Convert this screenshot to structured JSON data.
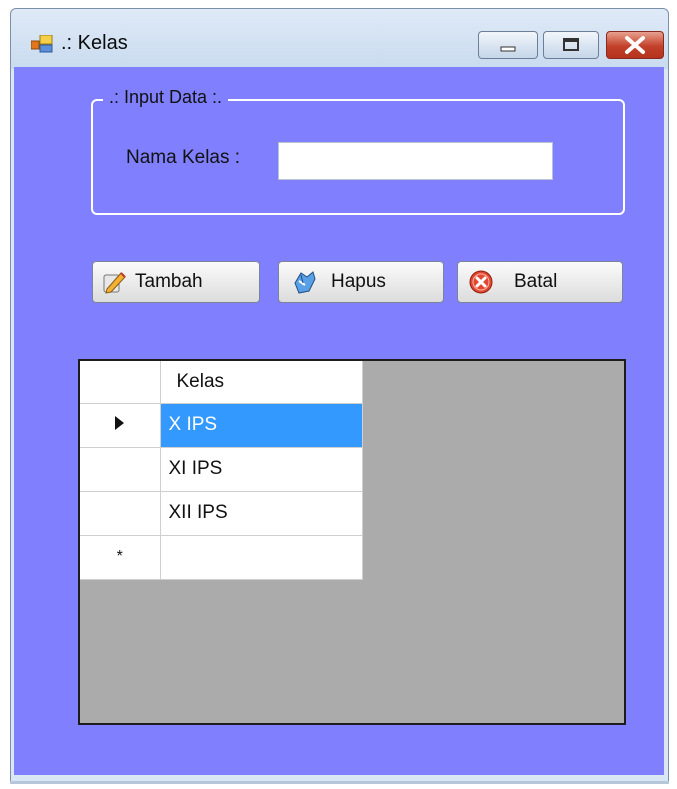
{
  "window": {
    "title": ".: Kelas",
    "icon": "app-form-icon",
    "controls": [
      "minimize-icon",
      "maximize-icon",
      "close-icon"
    ]
  },
  "input_group": {
    "legend": ".: Input Data :.",
    "nama_kelas_label": "Nama Kelas :",
    "nama_kelas_value": ""
  },
  "buttons": {
    "tambah": "Tambah",
    "hapus": "Hapus",
    "batal": "Batal"
  },
  "grid": {
    "columns": [
      "Kelas"
    ],
    "rows": [
      {
        "kelas": "X IPS",
        "selected": true,
        "indicator": "current-row-arrow"
      },
      {
        "kelas": "XI IPS",
        "selected": false,
        "indicator": ""
      },
      {
        "kelas": "XII IPS",
        "selected": false,
        "indicator": ""
      }
    ],
    "new_row_marker": "*"
  },
  "colors": {
    "form_background": "#8080ff",
    "selection": "#3399ff",
    "grid_background": "#ababab",
    "close_button": "#c2412a"
  }
}
